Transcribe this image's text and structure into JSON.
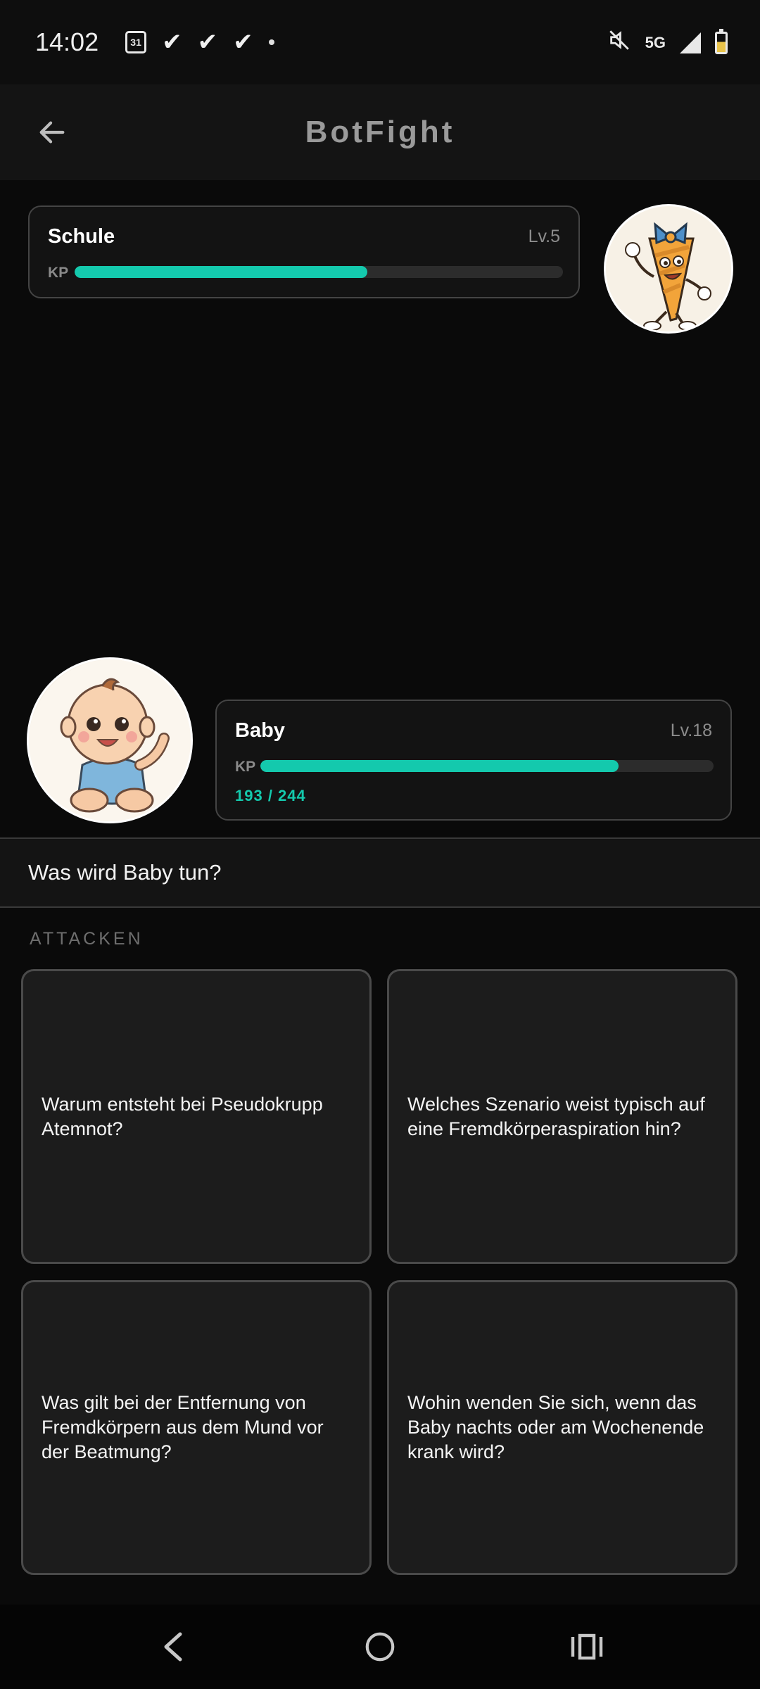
{
  "status_bar": {
    "time": "14:02",
    "calendar_day": "31",
    "network": "5G",
    "icons": [
      "calendar-icon",
      "check-icon",
      "check-icon",
      "check-icon",
      "dot-icon",
      "mute-icon",
      "signal-icon",
      "battery-icon"
    ]
  },
  "app_bar": {
    "title": "BotFight",
    "back_icon": "arrow-left-icon"
  },
  "opponent": {
    "name": "Schule",
    "level": "Lv.5",
    "hp_label": "KP",
    "hp_fraction": 0.6,
    "avatar": "school-cone-mascot"
  },
  "player": {
    "name": "Baby",
    "level": "Lv.18",
    "hp_label": "KP",
    "hp_text": "193 / 244",
    "hp_current": 193,
    "hp_max": 244,
    "avatar": "baby-mascot"
  },
  "prompt": {
    "text": "Was wird Baby tun?"
  },
  "attacks": {
    "label": "ATTACKEN",
    "items": [
      {
        "text": "Warum entsteht bei Pseudokrupp Atemnot?"
      },
      {
        "text": "Welches Szenario weist typisch auf eine Fremdkörperaspiration hin?"
      },
      {
        "text": "Was gilt bei der Entfernung von Fremdkörpern aus dem Mund vor der Beatmung?"
      },
      {
        "text": "Wohin wenden Sie sich, wenn das Baby nachts oder am Wochenende krank wird?"
      }
    ]
  },
  "nav_bar": {
    "icons": [
      "nav-back-icon",
      "nav-home-icon",
      "nav-recents-icon"
    ]
  },
  "colors": {
    "accent": "#14c9ad",
    "background": "#0a0a0a",
    "card": "#1c1c1c"
  }
}
